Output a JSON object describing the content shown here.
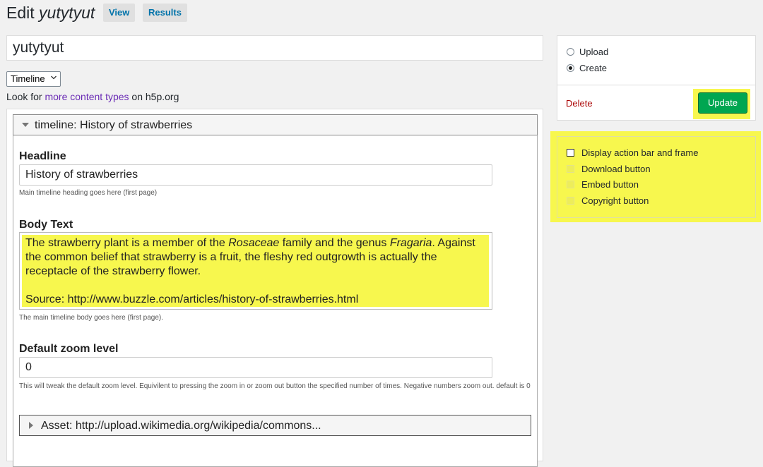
{
  "header": {
    "title_prefix": "Edit",
    "title_name": "yutytyut",
    "view_label": "View",
    "results_label": "Results"
  },
  "title_input": {
    "value": "yutytyut"
  },
  "library_select": {
    "selected": "Timeline"
  },
  "lookfor": {
    "prefix": "Look for ",
    "link": "more content types",
    "suffix": " on h5p.org"
  },
  "editor": {
    "timeline_header": "timeline: History of strawberries",
    "headline": {
      "label": "Headline",
      "value": "History of strawberries",
      "description": "Main timeline heading goes here (first page)"
    },
    "body": {
      "label": "Body Text",
      "line1_a": "The strawberry plant is a member of the ",
      "line1_em1": "Rosaceae",
      "line1_b": " family and the genus ",
      "line1_em2": "Fragaria",
      "line1_c": ". Against the common belief that strawberry is a fruit, the fleshy red outgrowth is actually the receptacle of the strawberry flower.",
      "source": "Source: http://www.buzzle.com/articles/history-of-strawberries.html",
      "description": "The main timeline body goes here (first page)."
    },
    "zoom": {
      "label": "Default zoom level",
      "value": "0",
      "description": "This will tweak the default zoom level. Equivilent to pressing the zoom in or zoom out button the specified number of times. Negative numbers zoom out. default is 0"
    },
    "asset_label": "Asset: http://upload.wikimedia.org/wikipedia/commons..."
  },
  "sidebar": {
    "upload_label": "Upload",
    "create_label": "Create",
    "delete_label": "Delete",
    "update_label": "Update"
  },
  "display_options": {
    "display_frame": "Display action bar and frame",
    "download": "Download button",
    "embed": "Embed button",
    "copyright": "Copyright button"
  },
  "colors": {
    "highlight": "#f7f74e",
    "update_button": "#00a651",
    "link": "#0073aa",
    "delete": "#aa0000"
  }
}
